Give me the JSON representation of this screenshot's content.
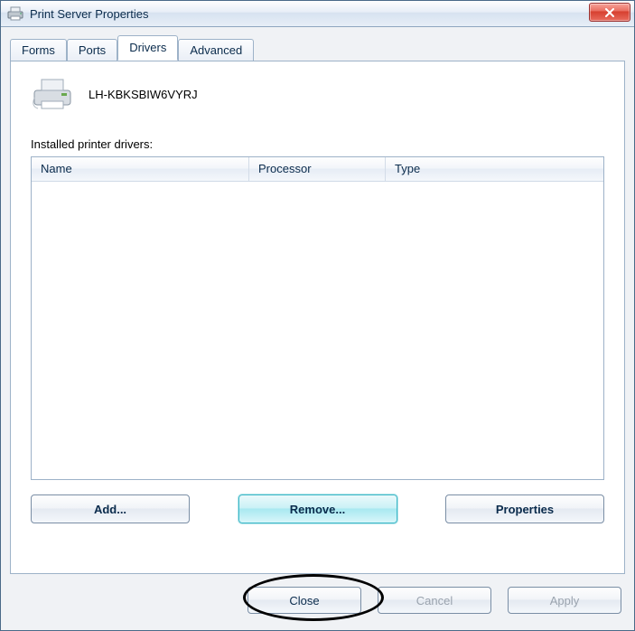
{
  "title": "Print Server Properties",
  "tabs": [
    "Forms",
    "Ports",
    "Drivers",
    "Advanced"
  ],
  "active_tab_index": 2,
  "server_name": "LH-KBKSBIW6VYRJ",
  "section_label": "Installed printer drivers:",
  "columns": {
    "name": "Name",
    "processor": "Processor",
    "type": "Type"
  },
  "panel_buttons": {
    "add": "Add...",
    "remove": "Remove...",
    "properties": "Properties"
  },
  "bottom_buttons": {
    "close": "Close",
    "cancel": "Cancel",
    "apply": "Apply"
  }
}
